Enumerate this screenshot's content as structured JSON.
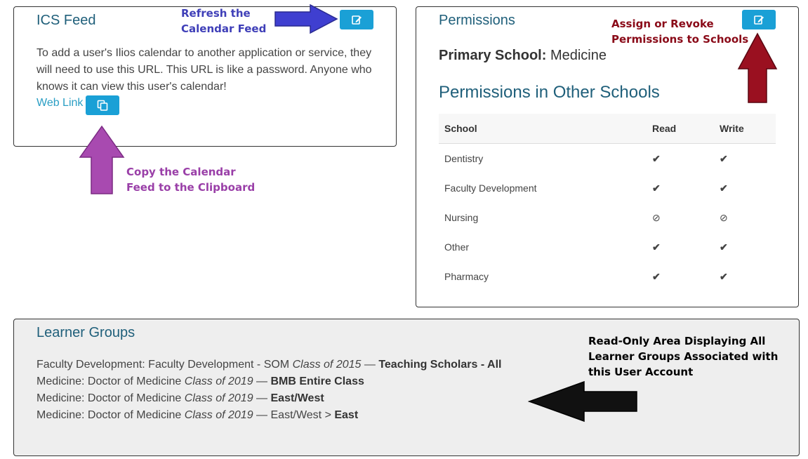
{
  "ics": {
    "title": "ICS Feed",
    "description": "To add a user's Ilios calendar to another application or service, they will need to use this URL. This URL is like a password. Anyone who knows it can view this user's calendar!",
    "web_link": "Web Link"
  },
  "permissions": {
    "title": "Permissions",
    "primary_label": "Primary School:",
    "primary_value": "Medicine",
    "other_title": "Permissions in Other Schools",
    "columns": [
      "School",
      "Read",
      "Write"
    ],
    "rows": [
      {
        "school": "Dentistry",
        "read": "✔",
        "write": "✔"
      },
      {
        "school": "Faculty Development",
        "read": "✔",
        "write": "✔"
      },
      {
        "school": "Nursing",
        "read": "⊘",
        "write": "⊘"
      },
      {
        "school": "Other",
        "read": "✔",
        "write": "✔"
      },
      {
        "school": "Pharmacy",
        "read": "✔",
        "write": "✔"
      }
    ]
  },
  "learner_groups": {
    "title": "Learner Groups",
    "rows": [
      {
        "prefix": "Faculty Development: Faculty Development - SOM ",
        "cohort": "Class of 2015",
        "sep": " — ",
        "group": "Teaching Scholars - All",
        "sub": ""
      },
      {
        "prefix": "Medicine: Doctor of Medicine ",
        "cohort": "Class of 2019",
        "sep": " — ",
        "group": "BMB Entire Class",
        "sub": ""
      },
      {
        "prefix": "Medicine: Doctor of Medicine ",
        "cohort": "Class of 2019",
        "sep": " — ",
        "group": "East/West",
        "sub": ""
      },
      {
        "prefix": "Medicine: Doctor of Medicine ",
        "cohort": "Class of 2019",
        "sep": " — East/West > ",
        "group": "East",
        "sub": ""
      }
    ]
  },
  "annotations": {
    "refresh_line1": "Refresh the",
    "refresh_line2": "Calendar Feed",
    "copy_line1": "Copy the Calendar",
    "copy_line2": "Feed to the Clipboard",
    "assign_line1": "Assign or Revoke",
    "assign_line2": "Permissions to Schools",
    "readonly_line1": "Read-Only Area Displaying All",
    "readonly_line2": "Learner Groups Associated with",
    "readonly_line3": "this User Account"
  },
  "colors": {
    "accent_button": "#1aa0d6",
    "title_teal": "#1f5f7a",
    "check_green": "#6aa84f",
    "ban_red": "#b03030"
  },
  "icons": {
    "edit": "edit-icon",
    "copy": "copy-icon",
    "check": "check-icon",
    "ban": "ban-icon"
  }
}
